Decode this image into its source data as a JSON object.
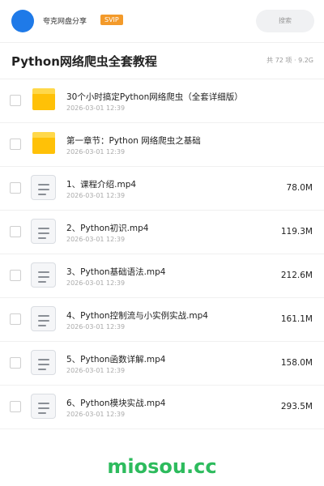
{
  "header": {
    "account_name": "夸克网盘分享",
    "vip_badge": "SVIP",
    "search_placeholder": "搜索"
  },
  "folder": {
    "title": "Python网络爬虫全套教程",
    "meta": "共 72 项 · 9.2G"
  },
  "files": [
    {
      "type": "folder",
      "name": "30个小时搞定Python网络爬虫（全套详细版）",
      "date": "2026-03-01 12:39",
      "size": ""
    },
    {
      "type": "folder",
      "name": "第一章节：Python 网络爬虫之基础",
      "date": "2026-03-01 12:39",
      "size": ""
    },
    {
      "type": "file",
      "name": "1、课程介绍.mp4",
      "date": "2026-03-01 12:39",
      "size": "78.0M"
    },
    {
      "type": "file",
      "name": "2、Python初识.mp4",
      "date": "2026-03-01 12:39",
      "size": "119.3M"
    },
    {
      "type": "file",
      "name": "3、Python基础语法.mp4",
      "date": "2026-03-01 12:39",
      "size": "212.6M"
    },
    {
      "type": "file",
      "name": "4、Python控制流与小实例实战.mp4",
      "date": "2026-03-01 12:39",
      "size": "161.1M"
    },
    {
      "type": "file",
      "name": "5、Python函数详解.mp4",
      "date": "2026-03-01 12:39",
      "size": "158.0M"
    },
    {
      "type": "file",
      "name": "6、Python模块实战.mp4",
      "date": "2026-03-01 12:39",
      "size": "293.5M"
    }
  ],
  "watermark": "miosou.cc",
  "icons": {
    "folder": "folder-icon",
    "file": "document-icon"
  },
  "colors": {
    "accent": "#1f7ae8",
    "vip": "#f39a2a",
    "folder": "#ffc107",
    "watermark": "#2dbb5d"
  }
}
